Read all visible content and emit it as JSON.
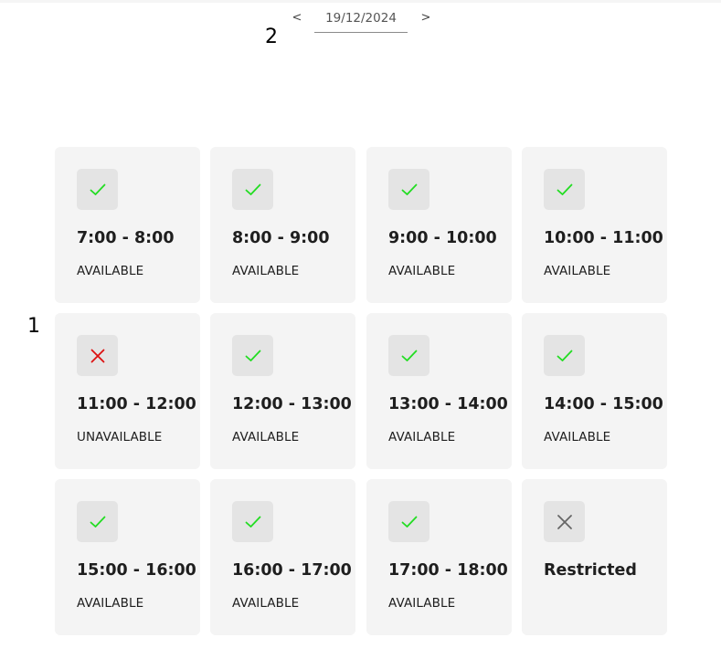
{
  "date_nav": {
    "prev_label": "<",
    "next_label": ">",
    "date_value": "19/12/2024"
  },
  "markers": {
    "one": "1",
    "two": "2"
  },
  "colors": {
    "available": "#22dd22",
    "unavailable": "#dd1111",
    "restricted": "#666666"
  },
  "slots": [
    {
      "time": "7:00 - 8:00",
      "status": "AVAILABLE",
      "icon": "check-icon"
    },
    {
      "time": "8:00 - 9:00",
      "status": "AVAILABLE",
      "icon": "check-icon"
    },
    {
      "time": "9:00 - 10:00",
      "status": "AVAILABLE",
      "icon": "check-icon"
    },
    {
      "time": "10:00 - 11:00",
      "status": "AVAILABLE",
      "icon": "check-icon"
    },
    {
      "time": "11:00 - 12:00",
      "status": "UNAVAILABLE",
      "icon": "cross-icon"
    },
    {
      "time": "12:00 - 13:00",
      "status": "AVAILABLE",
      "icon": "check-icon"
    },
    {
      "time": "13:00 - 14:00",
      "status": "AVAILABLE",
      "icon": "check-icon"
    },
    {
      "time": "14:00 - 15:00",
      "status": "AVAILABLE",
      "icon": "check-icon"
    },
    {
      "time": "15:00 - 16:00",
      "status": "AVAILABLE",
      "icon": "check-icon"
    },
    {
      "time": "16:00 - 17:00",
      "status": "AVAILABLE",
      "icon": "check-icon"
    },
    {
      "time": "17:00 - 18:00",
      "status": "AVAILABLE",
      "icon": "check-icon"
    },
    {
      "time": "Restricted",
      "status": "",
      "icon": "restricted-x-icon"
    }
  ]
}
